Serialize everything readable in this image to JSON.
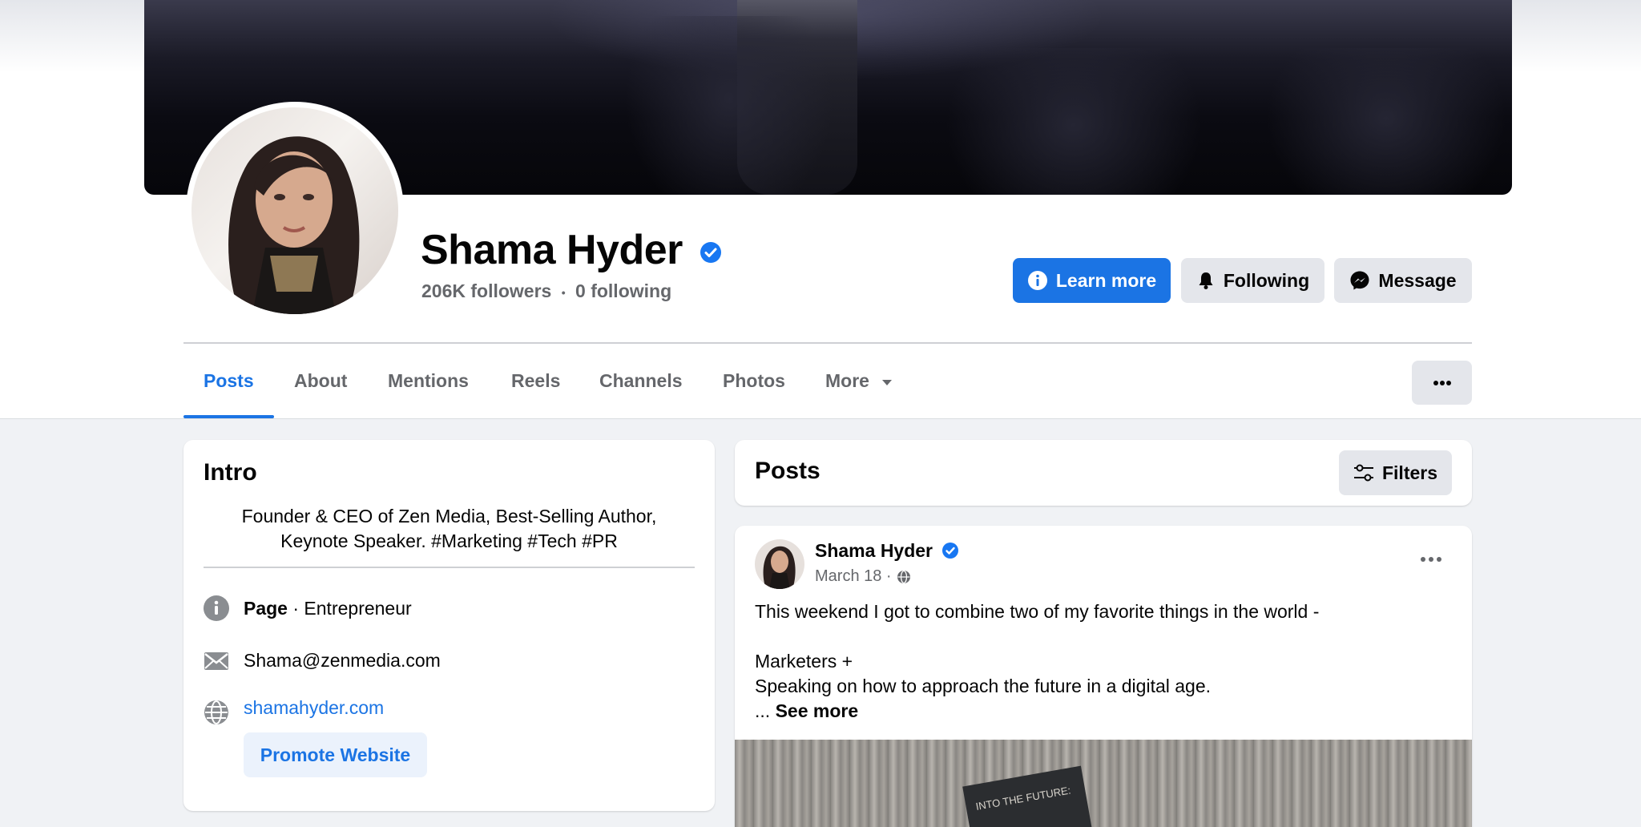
{
  "profile": {
    "name": "Shama Hyder",
    "followers": "206K followers",
    "separator": "•",
    "following": "0 following"
  },
  "actions": {
    "learn_more": "Learn more",
    "following": "Following",
    "message": "Message"
  },
  "tabs": [
    {
      "label": "Posts",
      "active": true
    },
    {
      "label": "About"
    },
    {
      "label": "Mentions"
    },
    {
      "label": "Reels"
    },
    {
      "label": "Channels"
    },
    {
      "label": "Photos"
    },
    {
      "label": "More"
    }
  ],
  "intro": {
    "title": "Intro",
    "bio_line1": "Founder & CEO of Zen Media, Best-Selling Author,",
    "bio_line2": "Keynote Speaker. #Marketing #Tech #PR",
    "category_label": "Page",
    "category_value": "· Entrepreneur",
    "email": "Shama@zenmedia.com",
    "website": "shamahyder.com",
    "promote_button": "Promote Website"
  },
  "posts_header": {
    "title": "Posts",
    "filters_label": "Filters"
  },
  "post": {
    "author": "Shama Hyder",
    "date": "March 18 ·",
    "line1": "This weekend I got to combine two of my favorite things in the world -",
    "line2": "Marketers +",
    "line3": "Speaking on how to approach the future in a digital age.",
    "ellipsis": "...",
    "see_more": "See more",
    "image_sign_text": "INTO THE FUTURE:"
  },
  "icons": {
    "verified": "verified-badge-icon",
    "info": "info-icon",
    "bell": "bell-icon",
    "messenger": "messenger-icon",
    "more": "more-horizontal-icon",
    "caret": "caret-down-icon",
    "email": "envelope-icon",
    "globe": "globe-icon",
    "filters": "filters-icon"
  },
  "colors": {
    "accent": "#1b74e4",
    "verified": "#1877f2",
    "secondary_button": "#e4e6eb",
    "muted_text": "#65676b",
    "page_background": "#f0f2f5"
  }
}
